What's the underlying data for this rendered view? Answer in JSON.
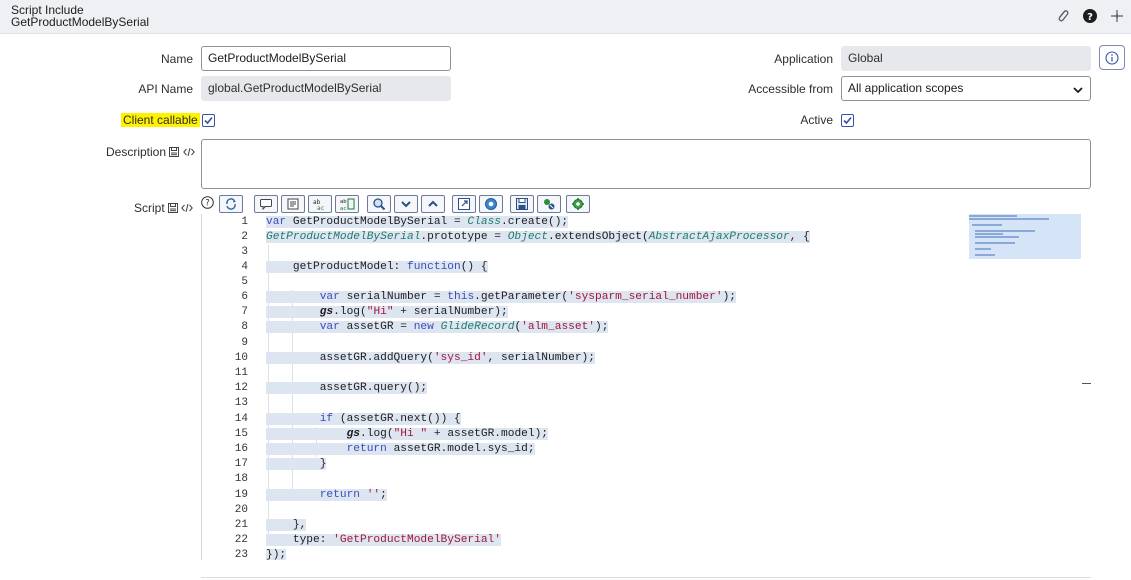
{
  "header": {
    "record_type": "Script Include",
    "record_name": "GetProductModelBySerial",
    "icons": [
      "paperclip-icon",
      "help-icon",
      "more-icon"
    ]
  },
  "form": {
    "name_label": "Name",
    "name_value": "GetProductModelBySerial",
    "api_name_label": "API Name",
    "api_name_value": "global.GetProductModelBySerial",
    "client_callable_label": "Client callable",
    "client_callable_checked": true,
    "description_label": "Description",
    "description_value": "",
    "script_label": "Script",
    "application_label": "Application",
    "application_value": "Global",
    "accessible_from_label": "Accessible from",
    "accessible_from_value": "All application scopes",
    "active_label": "Active",
    "active_checked": true
  },
  "toolbar": {
    "buttons": [
      "help-icon",
      "toggle-syntax-icon",
      "comment-icon",
      "format-icon",
      "replace-icon",
      "replace-all-icon",
      "search-icon",
      "find-next-icon",
      "find-previous-icon",
      "fullscreen-icon",
      "script-debugger-icon",
      "save-icon",
      "script-test-icon",
      "script-settings-icon"
    ]
  },
  "editor": {
    "line_numbers": [
      "1",
      "2",
      "3",
      "4",
      "5",
      "6",
      "7",
      "8",
      "9",
      "10",
      "11",
      "12",
      "13",
      "14",
      "15",
      "16",
      "17",
      "18",
      "19",
      "20",
      "21",
      "22",
      "23"
    ],
    "lines": [
      "var GetProductModelBySerial = Class.create();",
      "GetProductModelBySerial.prototype = Object.extendsObject(AbstractAjaxProcessor, {",
      "",
      "    getProductModel: function() {",
      "",
      "        var serialNumber = this.getParameter('sysparm_serial_number');",
      "        gs.log(\"Hi\" + serialNumber);",
      "        var assetGR = new GlideRecord('alm_asset');",
      "",
      "        assetGR.addQuery('sys_id', serialNumber);",
      "",
      "        assetGR.query();",
      "",
      "        if (assetGR.next()) {",
      "            gs.log(\"Hi \" + assetGR.model);",
      "            return assetGR.model.sys_id;",
      "        }",
      "",
      "        return '';",
      "",
      "    },",
      "    type: 'GetProductModelBySerial'",
      "});"
    ]
  },
  "colors": {
    "header_bg": "#eef0f3",
    "highlight": "#fff200",
    "checkbox": "#3a4fa6",
    "keyword": "#3a4dbb",
    "string": "#a3173a",
    "selection": "#dde5f1"
  }
}
